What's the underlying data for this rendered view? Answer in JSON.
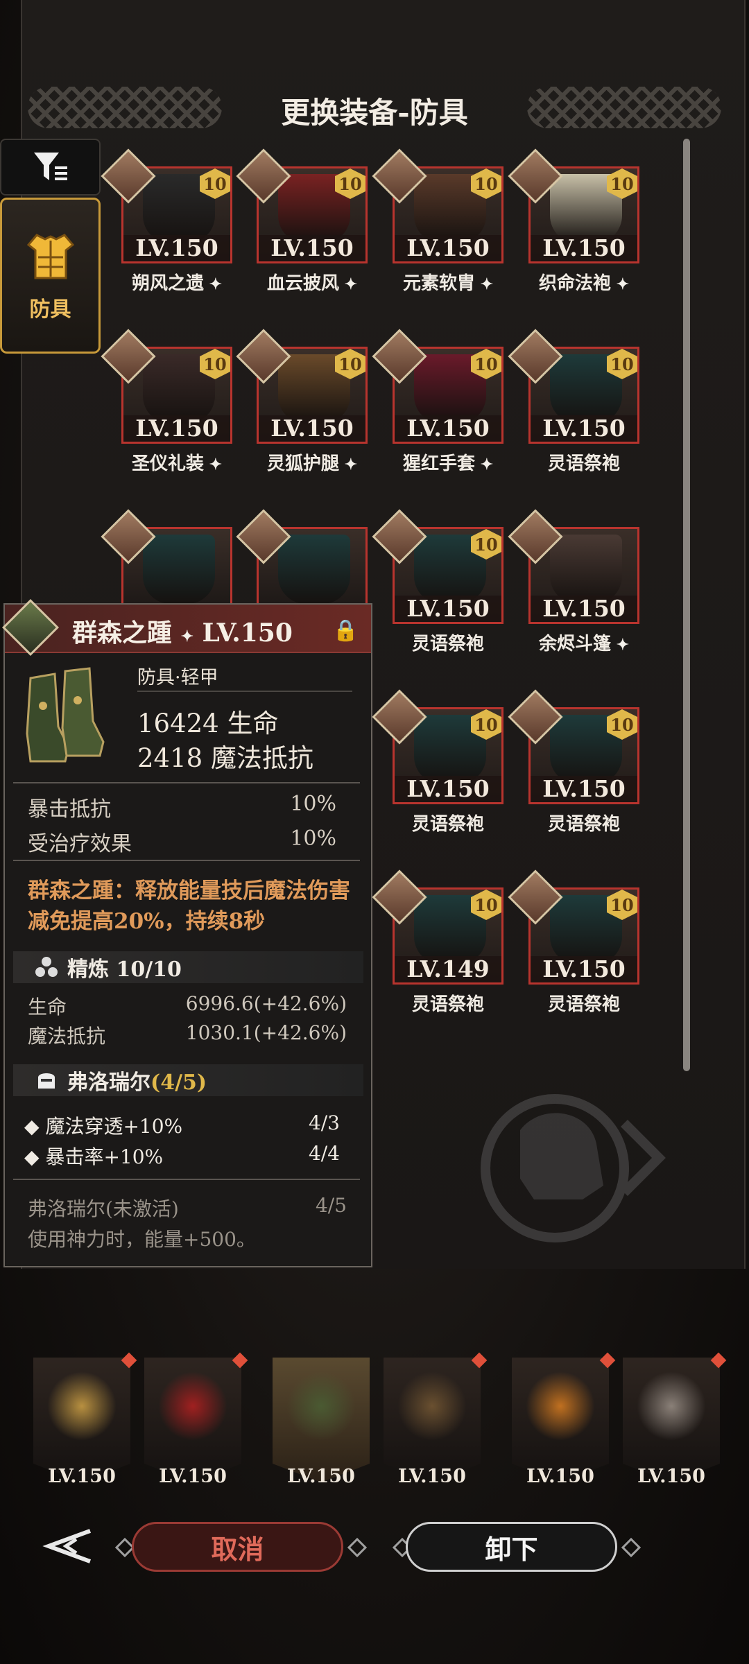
{
  "header": {
    "title": "更换装备-防具"
  },
  "tabs": {
    "armor_label": "防具"
  },
  "grid": [
    {
      "name": "朔风之遗",
      "lv": "LV.150",
      "badge": "10",
      "starred": true
    },
    {
      "name": "血云披风",
      "lv": "LV.150",
      "badge": "10",
      "starred": true
    },
    {
      "name": "元素软胄",
      "lv": "LV.150",
      "badge": "10",
      "starred": true
    },
    {
      "name": "织命法袍",
      "lv": "LV.150",
      "badge": "10",
      "starred": true
    },
    {
      "name": "圣仪礼装",
      "lv": "LV.150",
      "badge": "10",
      "starred": true
    },
    {
      "name": "灵狐护腿",
      "lv": "LV.150",
      "badge": "10",
      "starred": true
    },
    {
      "name": "猩红手套",
      "lv": "LV.150",
      "badge": "10",
      "starred": true
    },
    {
      "name": "灵语祭袍",
      "lv": "LV.150",
      "badge": "10",
      "starred": false
    },
    {
      "name": "灵语祭袍",
      "lv": "LV.150",
      "badge": "10",
      "starred": false
    },
    {
      "name": "余烬斗篷",
      "lv": "LV.150",
      "badge": "",
      "starred": true
    },
    {
      "name": "灵语祭袍",
      "lv": "LV.150",
      "badge": "10",
      "starred": false
    },
    {
      "name": "灵语祭袍",
      "lv": "LV.150",
      "badge": "10",
      "starred": false
    },
    {
      "name": "灵语祭袍",
      "lv": "LV.149",
      "badge": "10",
      "starred": false
    },
    {
      "name": "灵语祭袍",
      "lv": "LV.150",
      "badge": "10",
      "starred": false
    }
  ],
  "detail": {
    "name": "群森之踵",
    "lv": "LV.150",
    "type": "防具·轻甲",
    "main_stat_1": "16424 生命",
    "main_stat_2": "2418 魔法抵抗",
    "sub_1_label": "暴击抵抗",
    "sub_1_value": "10%",
    "sub_2_label": "受治疗效果",
    "sub_2_value": "10%",
    "description": "群森之踵：释放能量技后魔法伤害减免提高20%，持续8秒",
    "refine_label": "精炼 10/10",
    "refine_1_label": "生命",
    "refine_1_value": "6996.6(+42.6%)",
    "refine_2_label": "魔法抵抗",
    "refine_2_value": "1030.1(+42.6%)",
    "set_title_name": "弗洛瑞尔",
    "set_title_count": "(4/5)",
    "set_1_label": "魔法穿透+10%",
    "set_1_value": "4/3",
    "set_2_label": "暴击率+10%",
    "set_2_value": "4/4",
    "set_inactive_label": "弗洛瑞尔(未激活)",
    "set_inactive_value": "4/5",
    "set_inactive_desc": "使用神力时，能量+500。"
  },
  "equipped": [
    {
      "lv": "LV.150",
      "icon": "crossbow-icon"
    },
    {
      "lv": "LV.150",
      "icon": "staff-icon"
    },
    {
      "lv": "LV.150",
      "icon": "boots-icon"
    },
    {
      "lv": "LV.150",
      "icon": "antler-crown-icon"
    },
    {
      "lv": "LV.150",
      "icon": "ring-icon"
    },
    {
      "lv": "LV.150",
      "icon": "spear-icon"
    }
  ],
  "buttons": {
    "cancel": "取消",
    "unload": "卸下"
  },
  "colors": {
    "accent_gold": "#e0b84a",
    "frame_red": "#b8342e",
    "desc_orange": "#e09a5a"
  }
}
